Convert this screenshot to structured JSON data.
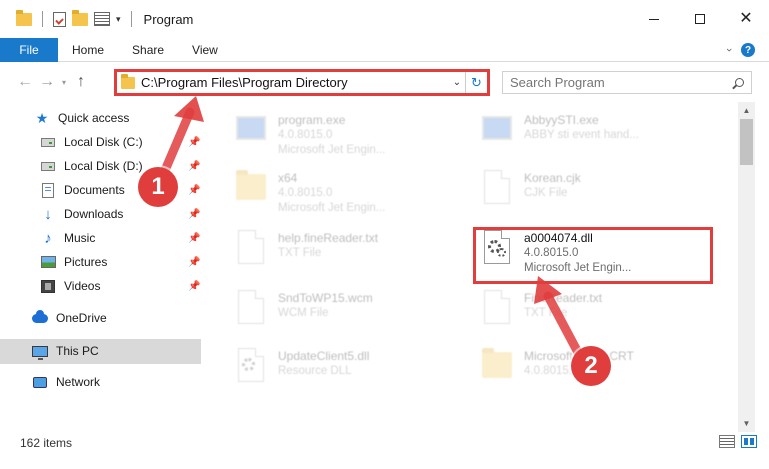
{
  "window": {
    "title": "Program",
    "controls": {
      "minimize": "",
      "maximize": "",
      "close": "✕"
    }
  },
  "ribbon": {
    "tabs": [
      "File",
      "Home",
      "Share",
      "View"
    ],
    "help": "?"
  },
  "nav": {
    "address": "C:\\Program Files\\Program Directory",
    "search_placeholder": "Search Program"
  },
  "sidebar": {
    "items": [
      {
        "label": "Quick access",
        "icon": "star-icon",
        "pinned": false
      },
      {
        "label": "Local Disk (C:)",
        "icon": "drive-icon",
        "pinned": true
      },
      {
        "label": "Local Disk (D:)",
        "icon": "drive-icon",
        "pinned": true
      },
      {
        "label": "Documents",
        "icon": "documents-icon",
        "pinned": true
      },
      {
        "label": "Downloads",
        "icon": "download-icon",
        "pinned": true
      },
      {
        "label": "Music",
        "icon": "music-icon",
        "pinned": true
      },
      {
        "label": "Pictures",
        "icon": "pictures-icon",
        "pinned": true
      },
      {
        "label": "Videos",
        "icon": "videos-icon",
        "pinned": true
      },
      {
        "label": "OneDrive",
        "icon": "cloud-icon",
        "pinned": false
      },
      {
        "label": "This PC",
        "icon": "computer-icon",
        "pinned": false,
        "selected": true
      },
      {
        "label": "Network",
        "icon": "network-icon",
        "pinned": false
      }
    ]
  },
  "files": [
    {
      "name": "program.exe",
      "line2": "4.0.8015.0",
      "line3": "Microsoft Jet Engin...",
      "icon": "exe-icon"
    },
    {
      "name": "AbbyySTI.exe",
      "line2": "ABBY sti event hand...",
      "line3": "",
      "icon": "exe-icon"
    },
    {
      "name": "x64",
      "line2": "4.0.8015.0",
      "line3": "Microsoft Jet Engin...",
      "icon": "folder-icon"
    },
    {
      "name": "Korean.cjk",
      "line2": "CJK File",
      "line3": "",
      "icon": "file-icon"
    },
    {
      "name": "help.fineReader.txt",
      "line2": "TXT File",
      "line3": "",
      "icon": "file-icon"
    },
    {
      "name": "a0004074.dll",
      "line2": "4.0.8015.0",
      "line3": "Microsoft Jet Engin...",
      "icon": "dll-icon",
      "highlight": true
    },
    {
      "name": "SndToWP15.wcm",
      "line2": "WCM File",
      "line3": "",
      "icon": "file-icon"
    },
    {
      "name": "FineReader.txt",
      "line2": "TXT File",
      "line3": "",
      "icon": "file-icon"
    },
    {
      "name": "UpdateClient5.dll",
      "line2": "Resource DLL",
      "line3": "",
      "icon": "dll-icon"
    },
    {
      "name": "Microsoft.VC90.CRT",
      "line2": "4.0.8015.0",
      "line3": "",
      "icon": "folder-icon"
    }
  ],
  "status": {
    "item_count": "162 items"
  },
  "callouts": [
    "1",
    "2"
  ],
  "colors": {
    "accent": "#1979ca",
    "annotation": "#e23c3c"
  }
}
